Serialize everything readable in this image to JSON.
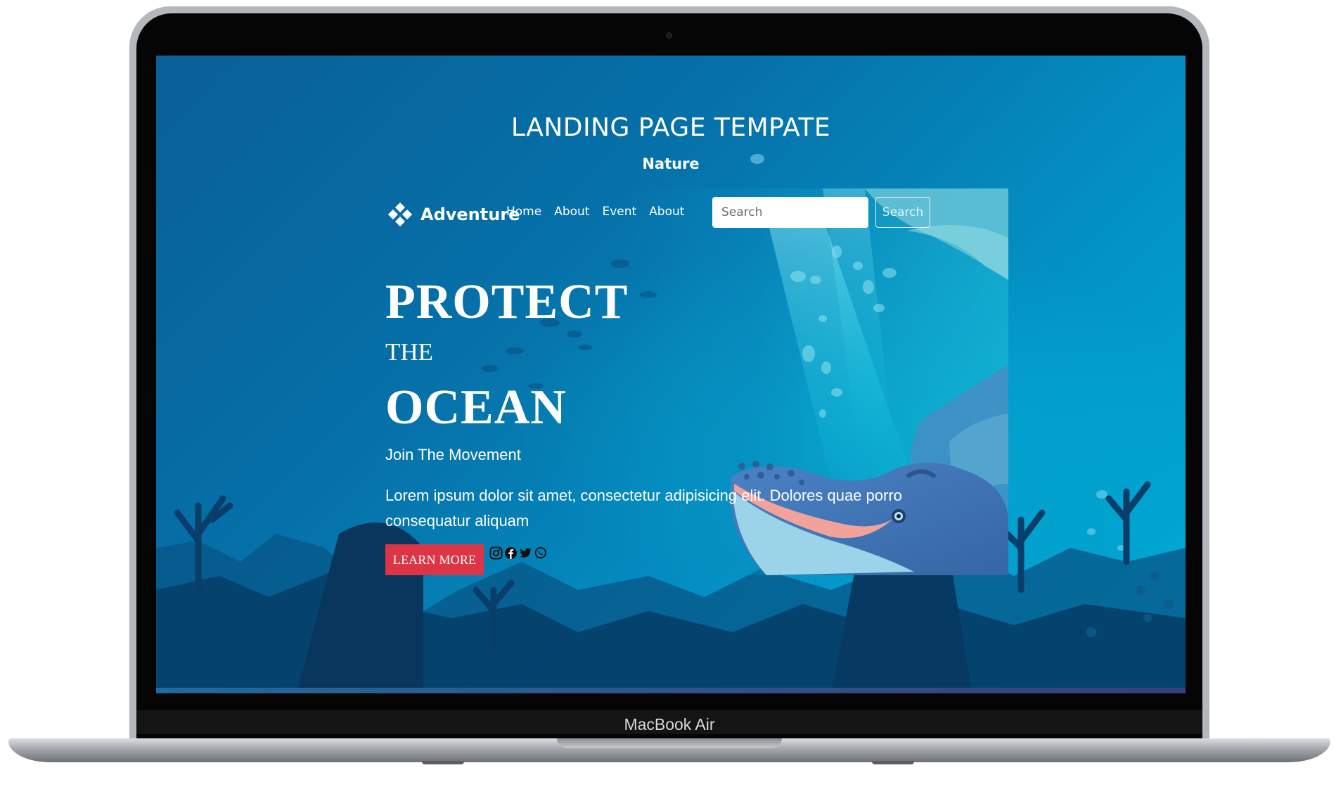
{
  "device": {
    "model_label": "MacBook Air"
  },
  "page": {
    "title": "LANDING PAGE TEMPATE",
    "subtitle": "Nature"
  },
  "navbar": {
    "brand": "Adventure",
    "brand_icon": "diamond-cluster-icon",
    "links": [
      "Home",
      "About",
      "Event",
      "About"
    ],
    "search": {
      "placeholder": "Search",
      "value": "",
      "button_label": "Search"
    }
  },
  "hero": {
    "line1": "PROTECT",
    "line2": "THE",
    "line3": "OCEAN",
    "tagline": "Join The Movement",
    "body": "Lorem ipsum dolor sit amet, consectetur adipisicing elit. Dolores quae porro consequatur aliquam",
    "cta_label": "LEARN MORE",
    "cta_color": "#dc3545"
  },
  "social_icons": [
    "instagram-icon",
    "facebook-icon",
    "twitter-icon",
    "whatsapp-icon"
  ],
  "colors": {
    "ocean_deep": "#0a5f97",
    "ocean_light": "#00aed6",
    "whale": "#3f74b5",
    "whale_belly": "#f1a29a"
  }
}
